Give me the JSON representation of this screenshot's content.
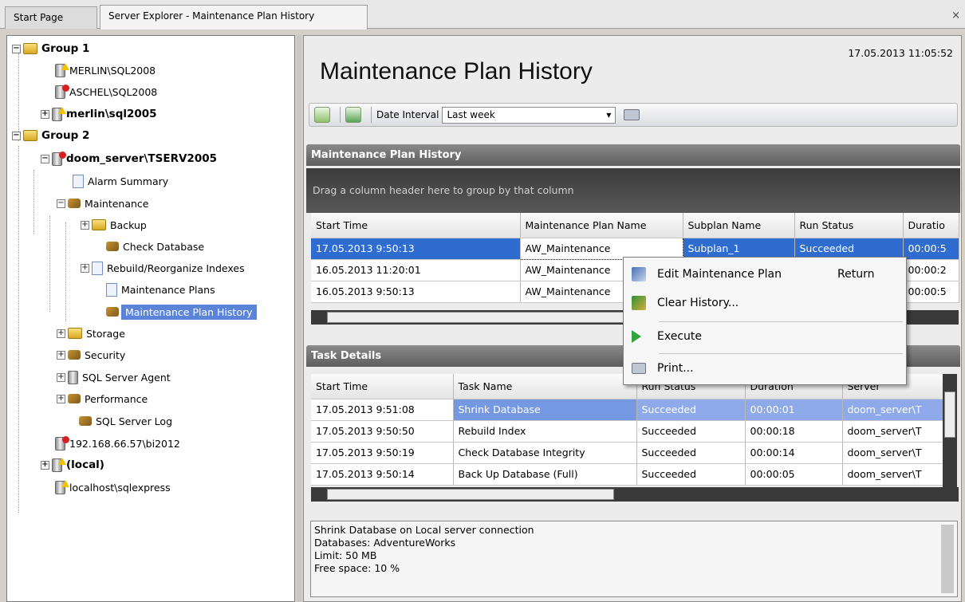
{
  "tabs": [
    {
      "label": "Start Page"
    },
    {
      "label": "Server Explorer - Maintenance Plan History"
    }
  ],
  "close_glyph": "×",
  "tree": {
    "nodes": [
      {
        "label": "Group 1"
      },
      {
        "label": "MERLIN\\SQL2008"
      },
      {
        "label": "ASCHEL\\SQL2008"
      },
      {
        "label": "merlin\\sql2005"
      },
      {
        "label": "Group 2"
      },
      {
        "label": "doom_server\\TSERV2005"
      },
      {
        "label": "Alarm Summary"
      },
      {
        "label": "Maintenance"
      },
      {
        "label": "Backup"
      },
      {
        "label": "Check Database"
      },
      {
        "label": "Rebuild/Reorganize Indexes"
      },
      {
        "label": "Maintenance Plans"
      },
      {
        "label": "Maintenance Plan History"
      },
      {
        "label": "Storage"
      },
      {
        "label": "Security"
      },
      {
        "label": "SQL Server Agent"
      },
      {
        "label": "Performance"
      },
      {
        "label": "SQL Server Log"
      },
      {
        "label": "192.168.66.57\\bi2012"
      },
      {
        "label": "(local)"
      },
      {
        "label": "localhost\\sqlexpress"
      }
    ]
  },
  "header": {
    "title": "Maintenance Plan History",
    "timestamp": "17.05.2013 11:05:52"
  },
  "toolbar": {
    "date_label": "Date Interval",
    "date_value": "Last week",
    "dropdown_glyph": "▾"
  },
  "history": {
    "panel_title": "Maintenance Plan History",
    "group_hint": "Drag a column header here to group by that column",
    "columns": [
      "Start Time",
      "Maintenance Plan Name",
      "Subplan Name",
      "Run Status",
      "Duratio"
    ],
    "rows": [
      [
        "17.05.2013 9:50:13",
        "AW_Maintenance",
        "Subplan_1",
        "Succeeded",
        "00:00:5"
      ],
      [
        "16.05.2013 11:20:01",
        "AW_Maintenance",
        "",
        "",
        "00:00:2"
      ],
      [
        "16.05.2013 9:50:13",
        "AW_Maintenance",
        "",
        "",
        "00:00:5"
      ]
    ]
  },
  "tasks": {
    "panel_title": "Task Details",
    "columns": [
      "Start Time",
      "Task Name",
      "Run Status",
      "Duration",
      "Server"
    ],
    "rows": [
      [
        "17.05.2013 9:51:08",
        "Shrink Database",
        "Succeeded",
        "00:00:01",
        "doom_server\\T"
      ],
      [
        "17.05.2013 9:50:50",
        "Rebuild Index",
        "Succeeded",
        "00:00:18",
        "doom_server\\T"
      ],
      [
        "17.05.2013 9:50:19",
        "Check Database Integrity",
        "Succeeded",
        "00:00:14",
        "doom_server\\T"
      ],
      [
        "17.05.2013 9:50:14",
        "Back Up Database (Full)",
        "Succeeded",
        "00:00:05",
        "doom_server\\T"
      ]
    ]
  },
  "context_menu": {
    "items": [
      {
        "label": "Edit Maintenance Plan",
        "shortcut": "Return",
        "icon": "edit-icon"
      },
      {
        "label": "Clear History...",
        "icon": "broom-icon"
      },
      {
        "label": "Execute",
        "icon": "play-icon"
      },
      {
        "label": "Print...",
        "icon": "printer-icon"
      }
    ]
  },
  "description": {
    "lines": [
      "Shrink Database on Local server connection",
      "Databases: AdventureWorks",
      "Limit: 50 MB",
      "Free space: 10 %"
    ]
  },
  "colors": {
    "selection": "#2f6cd0",
    "tree_selection": "#5b84d9",
    "panel_header": "#6e6e6e"
  }
}
